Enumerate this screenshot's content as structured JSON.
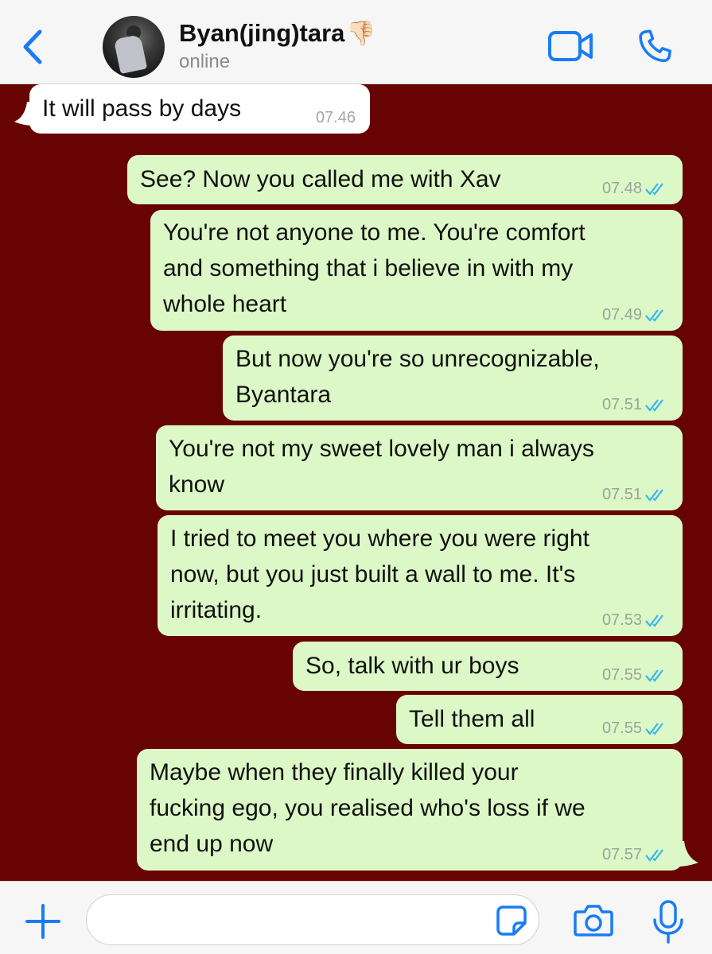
{
  "header": {
    "contact_name": "Byan(jing)tara",
    "name_emoji": "👎🏻",
    "status": "online"
  },
  "messages": [
    {
      "direction": "in",
      "text": "It will pass by days",
      "time": "07.46"
    },
    {
      "direction": "out",
      "text": "See? Now you called me with Xav",
      "time": "07.48",
      "read": true
    },
    {
      "direction": "out",
      "text": "You're not anyone to me. You're comfort\nand something that i believe in with my\nwhole heart",
      "time": "07.49",
      "read": true
    },
    {
      "direction": "out",
      "text": "But now you're so unrecognizable,\nByantara",
      "time": "07.51",
      "read": true
    },
    {
      "direction": "out",
      "text": "You're not my sweet lovely man i always\nknow",
      "time": "07.51",
      "read": true
    },
    {
      "direction": "out",
      "text": "I tried to meet you where you were right\nnow, but you just built a wall to me. It's\nirritating.",
      "time": "07.53",
      "read": true
    },
    {
      "direction": "out",
      "text": "So, talk with ur boys",
      "time": "07.55",
      "read": true
    },
    {
      "direction": "out",
      "text": "Tell them all",
      "time": "07.55",
      "read": true
    },
    {
      "direction": "out",
      "text": "Maybe when they finally killed your\nfucking ego, you realised who's loss if we\nend up now",
      "time": "07.57",
      "read": true
    }
  ],
  "composer": {
    "value": "",
    "placeholder": ""
  },
  "colors": {
    "accent": "#1a7cf5",
    "chat_background": "#670403",
    "outgoing_bubble": "#dcf8c6",
    "incoming_bubble": "#ffffff",
    "read_tick": "#34b7f1"
  },
  "icons": [
    "chevron-left-icon",
    "video-camera-icon",
    "phone-icon",
    "plus-icon",
    "sticker-icon",
    "camera-icon",
    "microphone-icon",
    "double-check-icon"
  ]
}
